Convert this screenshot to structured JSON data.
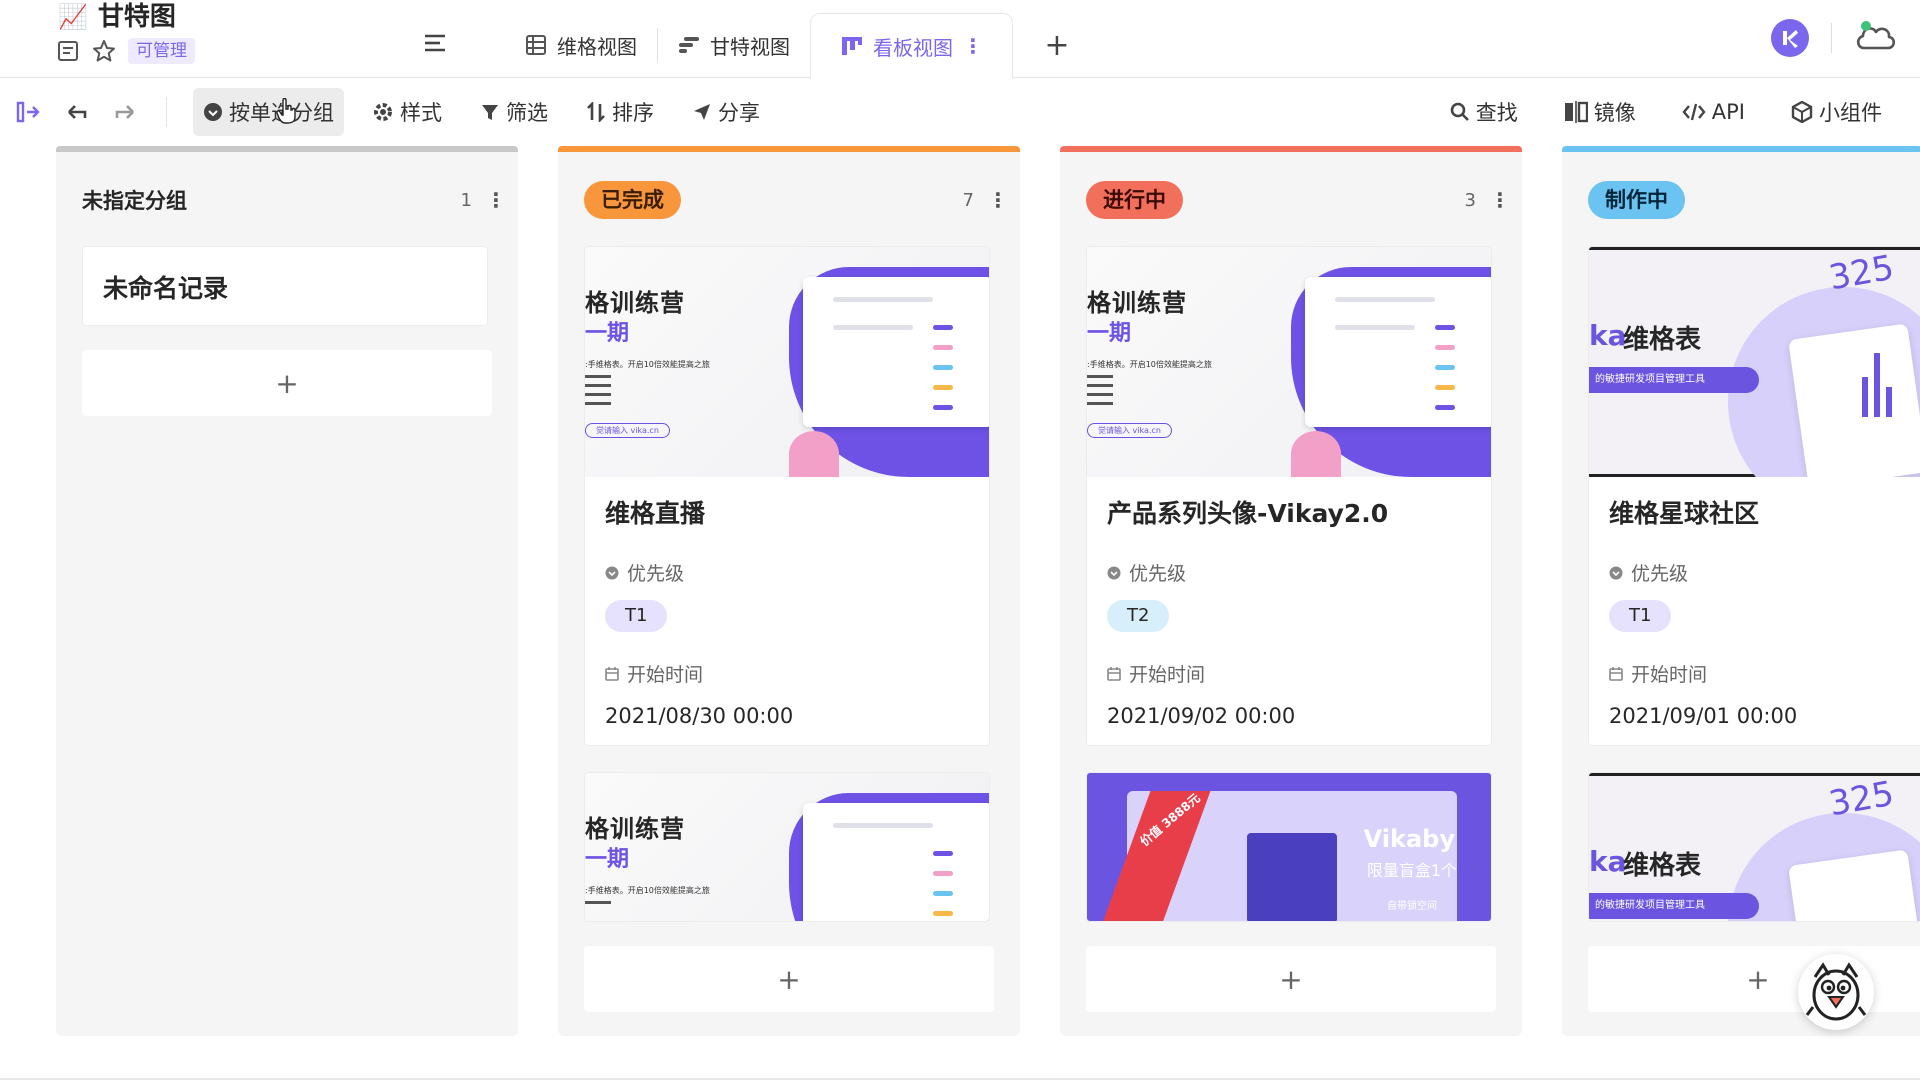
{
  "header": {
    "title_emoji": "📈",
    "title": "甘特图",
    "permission_badge": "可管理",
    "tabs": [
      {
        "label": "维格视图",
        "icon": "grid-view-icon"
      },
      {
        "label": "甘特视图",
        "icon": "gantt-view-icon"
      },
      {
        "label": "看板视图",
        "icon": "kanban-view-icon",
        "active": true
      }
    ],
    "add_tab": "+"
  },
  "toolbar": {
    "group": "按单选分组",
    "style": "样式",
    "filter": "筛选",
    "sort": "排序",
    "share": "分享",
    "search": "查找",
    "mirror": "镜像",
    "api": "API",
    "widget": "小组件"
  },
  "colors": {
    "accent": "#7b67ee",
    "done": "#f7963a",
    "inprogress": "#f2705b",
    "making": "#6ac3f0",
    "ungrouped": "#c8c8c8"
  },
  "columns": [
    {
      "title": "未指定分组",
      "count": "1",
      "cards": [
        {
          "title": "未命名记录"
        }
      ],
      "add": "+"
    },
    {
      "title": "已完成",
      "count": "7",
      "cards": [
        {
          "cover": {
            "h1": "格训练营",
            "h2": "一期",
            "sm": ":手维格表。开启10倍效能提高之旅",
            "url": "觉请输入 vika.cn"
          },
          "title": "维格直播",
          "priority_label": "优先级",
          "priority": "T1",
          "start_label": "开始时间",
          "start": "2021/08/30  00:00"
        },
        {
          "cover": {
            "h1": "格训练营",
            "h2": "一期",
            "sm": ":手维格表。开启10倍效能提高之旅"
          }
        }
      ],
      "add": "+"
    },
    {
      "title": "进行中",
      "count": "3",
      "cards": [
        {
          "cover": {
            "h1": "格训练营",
            "h2": "一期",
            "sm": ":手维格表。开启10倍效能提高之旅",
            "url": "觉请输入 vika.cn"
          },
          "title": "产品系列头像-Vikay2.0",
          "priority_label": "优先级",
          "priority": "T2",
          "start_label": "开始时间",
          "start": "2021/09/02  00:00"
        },
        {
          "cover": {
            "brand": "Vikaby",
            "line": "限量盲盒1个",
            "small": "自带锁空间",
            "badge": "价值 3888元"
          }
        }
      ],
      "add": "+"
    },
    {
      "title": "制作中",
      "count": "",
      "cards": [
        {
          "cover": {
            "number": "325",
            "prefix": "ka",
            "title": "维格表",
            "pill": "的敏捷研发项目管理工具"
          },
          "title": "维格星球社区",
          "priority_label": "优先级",
          "priority": "T1",
          "start_label": "开始时间",
          "start": "2021/09/01  00:00"
        },
        {
          "cover": {
            "number": "325",
            "prefix": "ka",
            "title": "维格表",
            "pill": "的敏捷研发项目管理工具"
          }
        }
      ],
      "add": "+"
    }
  ]
}
